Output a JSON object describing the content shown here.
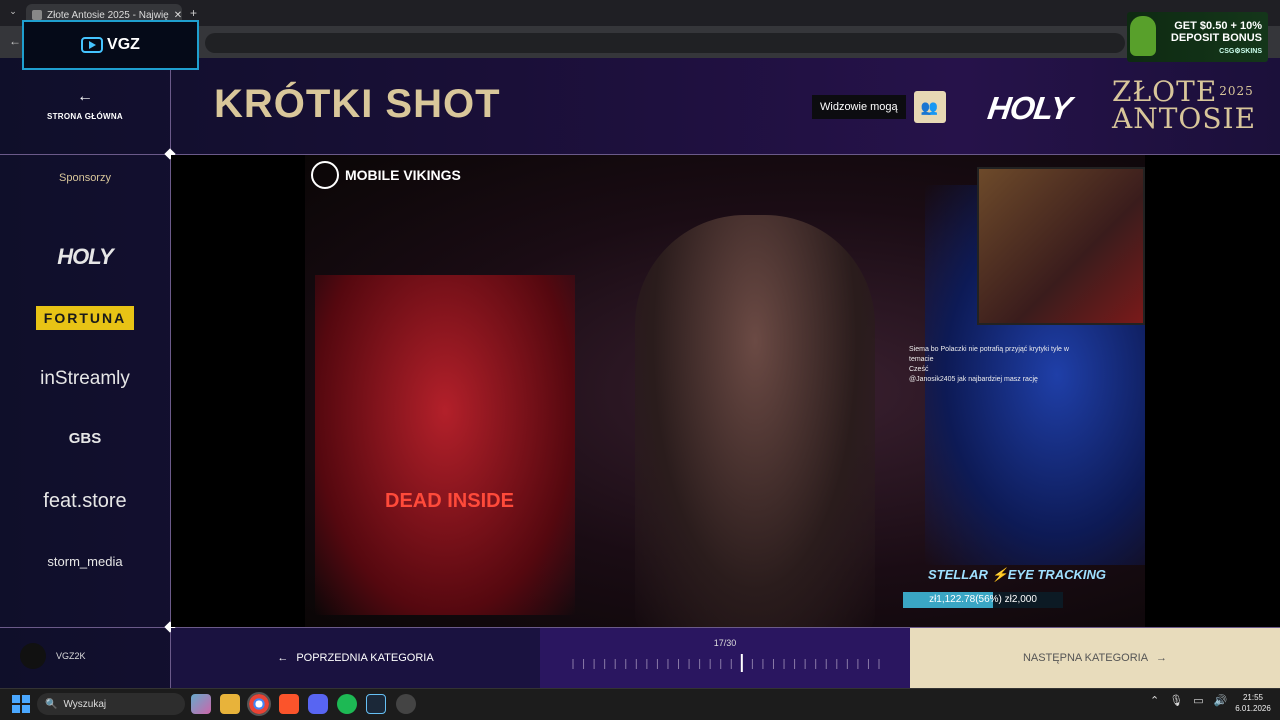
{
  "browser": {
    "tab_title": "Złote Antosie 2025 - Najwię",
    "tab_close": "✕",
    "new_tab": "+",
    "back": "←"
  },
  "overlay": {
    "vgz_logo": "VGZ"
  },
  "ad": {
    "line1": "GET $0.50 + 10%",
    "line2": "DEPOSIT BONUS",
    "brand": "CSG⚙SKINS"
  },
  "header": {
    "home_icon": "←",
    "home_label": "STRONA GŁÓWNA",
    "title": "KRÓTKI SHOT",
    "viewers_label": "Widzowie mogą",
    "viewers_icon": "👥",
    "holy_logo": "HOLY",
    "event_line1": "ZŁOTE",
    "event_year": "2025",
    "event_line2": "ANTOSIE"
  },
  "sidebar": {
    "title": "Sponsorzy",
    "sponsors": [
      "HOLY",
      "FORTUNA",
      "inStreamly",
      "GBS",
      "feat.store",
      "storm_media"
    ]
  },
  "video": {
    "brand": "MOBILE VIKINGS",
    "dead_inside": "DEAD INSIDE",
    "chat": [
      {
        "user": "",
        "msg": "Siema bo Polaczki nie potrafią przyjąć krytyki tyle w temacie"
      },
      {
        "user": "",
        "msg": "Cześć"
      },
      {
        "user": "",
        "msg": "@Janosik2405 jak najbardziej masz rację"
      }
    ],
    "goal_label": "STELLAR ⚡EYE TRACKING",
    "goal_text": "zł1,122.78(56%) zł2,000",
    "goal_fraction": 0.56
  },
  "footer": {
    "username": "VGZ2K",
    "prev_icon": "←",
    "prev_label": "POPRZEDNIA KATEGORIA",
    "progress_text": "17/30",
    "progress_current": 17,
    "progress_total": 30,
    "next_label": "NASTĘPNA KATEGORIA",
    "next_icon": "→"
  },
  "taskbar": {
    "search_placeholder": "Wyszukaj",
    "time": "21:55",
    "date": "6.01.2026"
  },
  "colors": {
    "gold": "#d9c79a",
    "accent": "#2a1660",
    "next_bg": "#e8dcbc"
  }
}
